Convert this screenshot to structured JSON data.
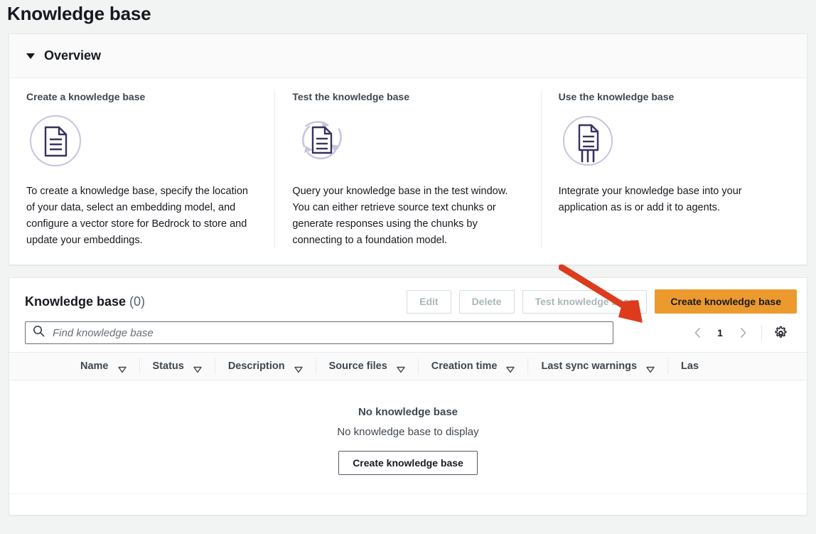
{
  "page": {
    "title": "Knowledge base"
  },
  "overview": {
    "section_title": "Overview",
    "caret_icon": "caret-down-icon",
    "columns": [
      {
        "heading": "Create a knowledge base",
        "icon": "document-in-circle-icon",
        "text": "To create a knowledge base, specify the location of your data, select an embedding model, and configure a vector store for Bedrock to store and update your embeddings."
      },
      {
        "heading": "Test the knowledge base",
        "icon": "document-with-sync-arrows-icon",
        "text": "Query your knowledge base in the test window. You can either retrieve source text chunks or generate responses using the chunks by connecting to a foundation model."
      },
      {
        "heading": "Use the knowledge base",
        "icon": "document-with-connectors-icon",
        "text": "Integrate your knowledge base into your application as is or add it to agents."
      }
    ]
  },
  "table_panel": {
    "title": "Knowledge base",
    "count": "(0)",
    "buttons": {
      "edit": "Edit",
      "delete": "Delete",
      "test": "Test knowledge base",
      "create": "Create knowledge base"
    },
    "search": {
      "placeholder": "Find knowledge base",
      "icon": "search-icon"
    },
    "pagination": {
      "prev_icon": "chevron-left-icon",
      "page": "1",
      "next_icon": "chevron-right-icon",
      "settings_icon": "gear-icon"
    },
    "columns": [
      {
        "label": "Name",
        "sort_icon": "sort-triangle-icon"
      },
      {
        "label": "Status",
        "sort_icon": "sort-triangle-icon"
      },
      {
        "label": "Description",
        "sort_icon": "sort-triangle-icon"
      },
      {
        "label": "Source files",
        "sort_icon": "sort-triangle-icon"
      },
      {
        "label": "Creation time",
        "sort_icon": "sort-triangle-icon"
      },
      {
        "label": "Last sync warnings",
        "sort_icon": "sort-triangle-icon"
      },
      {
        "label": "Las",
        "sort_icon": "sort-triangle-icon"
      }
    ],
    "empty_state": {
      "title": "No knowledge base",
      "subtitle": "No knowledge base to display",
      "button": "Create knowledge base"
    }
  },
  "annotation": {
    "arrow_icon": "red-arrow-pointing-to-create-button",
    "color": "#dc3b1e"
  },
  "colors": {
    "primary_button": "#ec9a2d",
    "icon_purple": "#3b3062",
    "icon_circle": "#c9c4de",
    "page_background": "#f2f3f3"
  }
}
